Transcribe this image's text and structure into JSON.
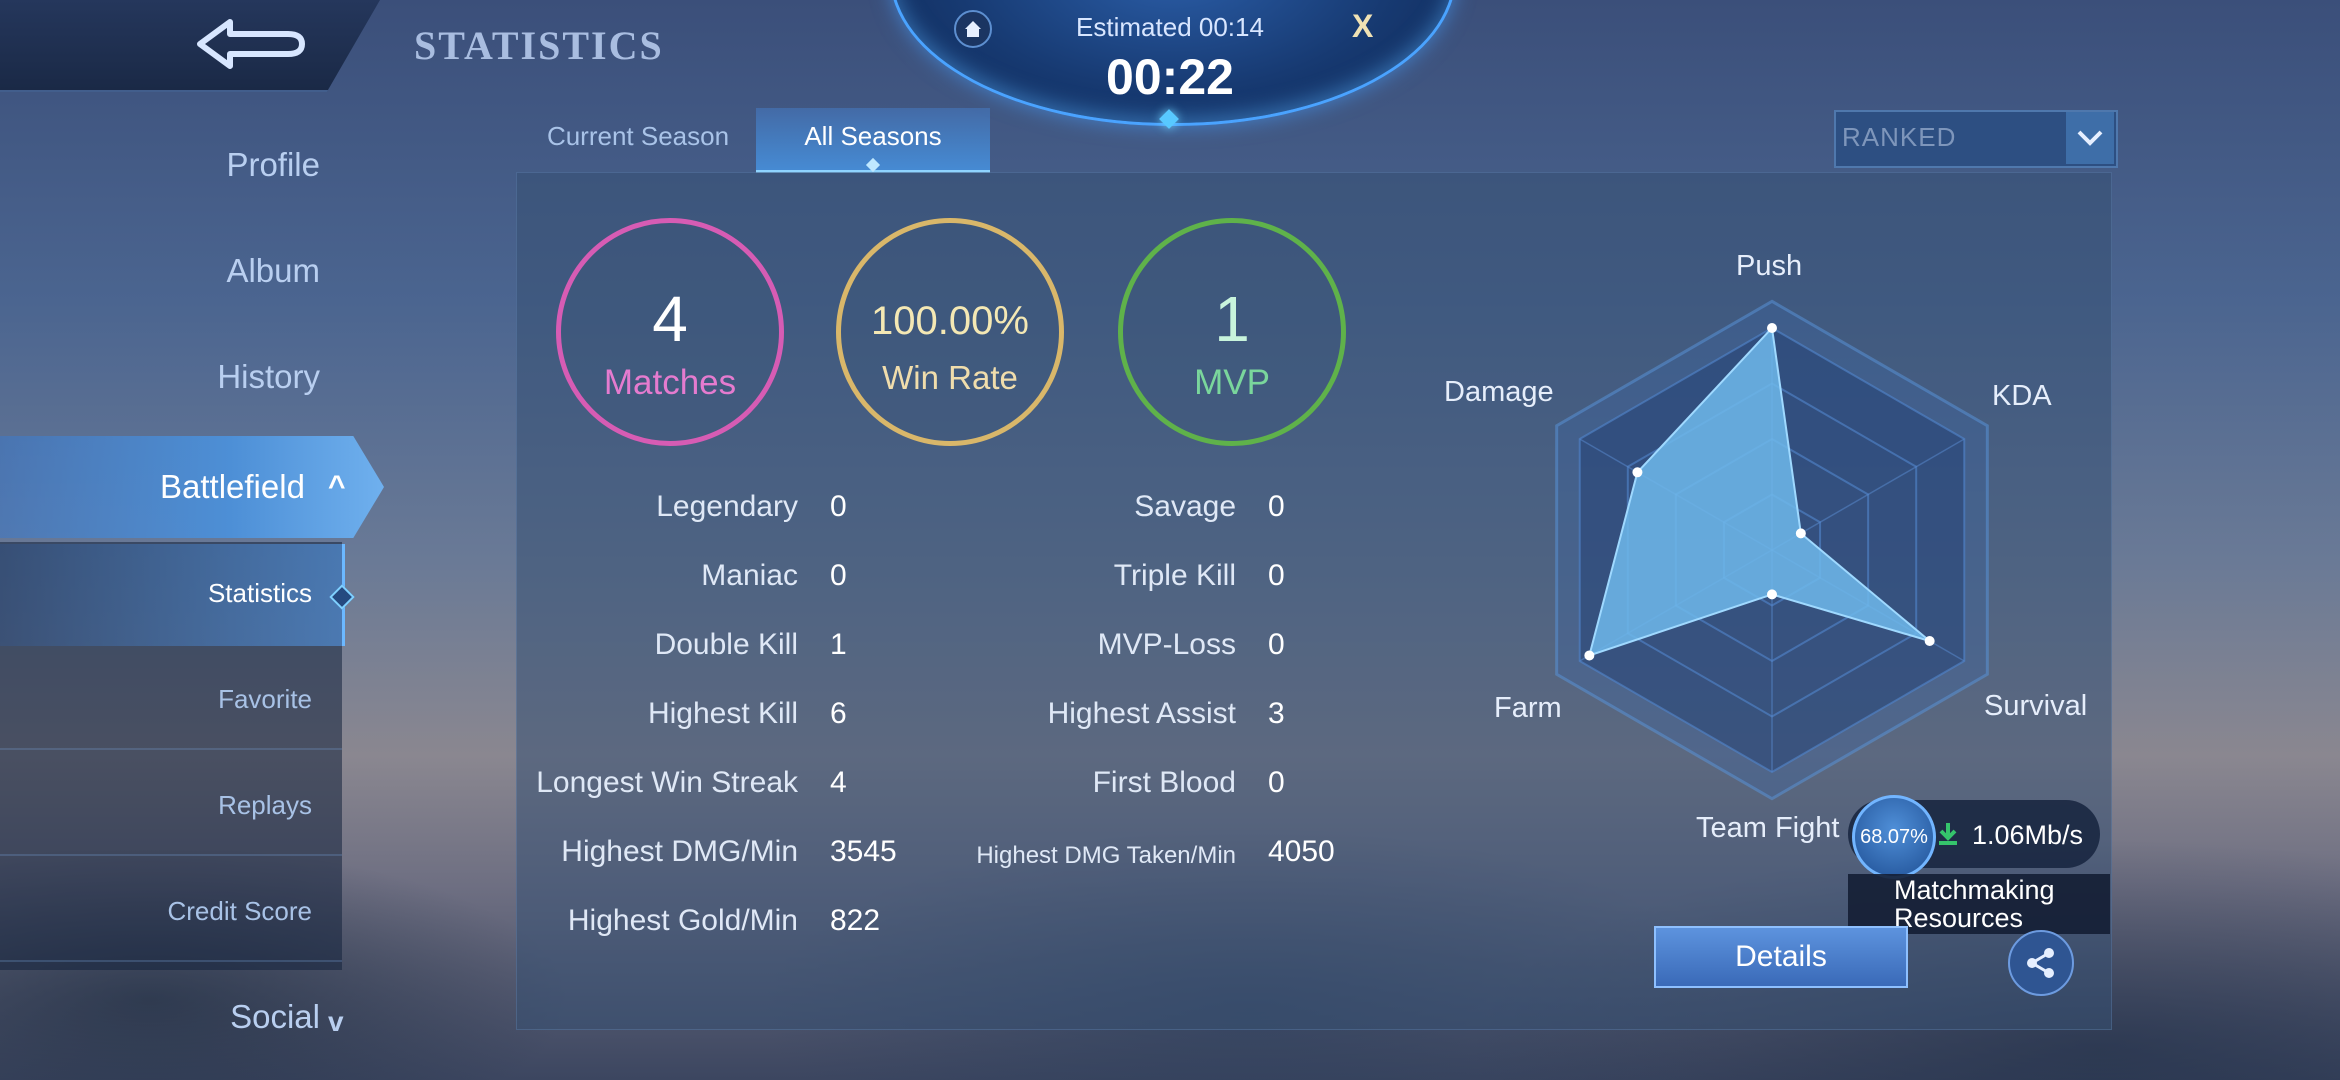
{
  "header": {
    "title": "STATISTICS"
  },
  "timer": {
    "estimated": "Estimated 00:14",
    "elapsed": "00:22",
    "close_label": "X"
  },
  "nav": {
    "items": [
      {
        "label": "Profile"
      },
      {
        "label": "Album"
      },
      {
        "label": "History"
      },
      {
        "label": "Battlefield"
      },
      {
        "label": "Social"
      }
    ],
    "sub_items": [
      {
        "label": "Statistics"
      },
      {
        "label": "Favorite"
      },
      {
        "label": "Replays"
      },
      {
        "label": "Credit Score"
      }
    ]
  },
  "tabs": [
    {
      "label": "Current Season"
    },
    {
      "label": "All Seasons"
    }
  ],
  "mode_select": {
    "value": "RANKED"
  },
  "summary": {
    "matches": {
      "value": "4",
      "label": "Matches",
      "color": "#d65cb4"
    },
    "win_rate": {
      "value": "100.00%",
      "label": "Win Rate",
      "color": "#d9b76a"
    },
    "mvp": {
      "value": "1",
      "label": "MVP",
      "color": "#5fb24a"
    }
  },
  "stats_left": [
    {
      "label": "Legendary",
      "value": "0"
    },
    {
      "label": "Maniac",
      "value": "0"
    },
    {
      "label": "Double Kill",
      "value": "1"
    },
    {
      "label": "Highest Kill",
      "value": "6"
    },
    {
      "label": "Longest Win Streak",
      "value": "4"
    },
    {
      "label": "Highest DMG/Min",
      "value": "3545"
    },
    {
      "label": "Highest Gold/Min",
      "value": "822"
    }
  ],
  "stats_right": [
    {
      "label": "Savage",
      "value": "0"
    },
    {
      "label": "Triple Kill",
      "value": "0"
    },
    {
      "label": "MVP-Loss",
      "value": "0"
    },
    {
      "label": "Highest Assist",
      "value": "3"
    },
    {
      "label": "First Blood",
      "value": "0"
    },
    {
      "label": "Highest DMG Taken/Min",
      "value": "4050"
    }
  ],
  "radar": {
    "axes": [
      "Push",
      "KDA",
      "Survival",
      "Team Fight",
      "Farm",
      "Damage"
    ],
    "values": [
      1.0,
      0.15,
      0.82,
      0.2,
      0.95,
      0.7
    ]
  },
  "network": {
    "progress": "68.07%",
    "speed": "1.06Mb/s",
    "caption": "Matchmaking Resources"
  },
  "buttons": {
    "details": "Details"
  }
}
